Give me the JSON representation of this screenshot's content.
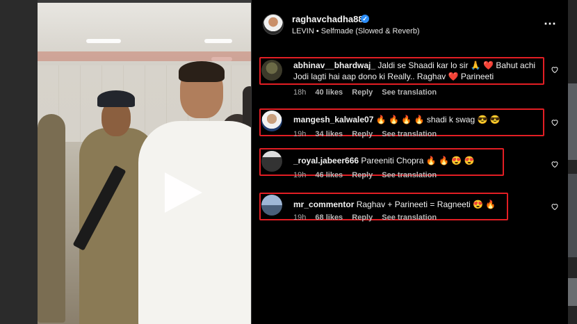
{
  "post": {
    "username": "raghavchadha88",
    "verified_mark": "✓",
    "audio": "LEVIN • Selfmade (Slowed & Reverb)",
    "more_icon": "⋯"
  },
  "video": {
    "play_icon": "play-icon"
  },
  "comments": [
    {
      "username": "abhinav__bhardwaj_",
      "text": "Jaldi se Shaadi kar lo sir 🙏 ❤️ Bahut achi Jodi lagti hai aap dono ki Really.. Raghav ❤️ Parineeti",
      "time": "18h",
      "likes": "40 likes",
      "reply": "Reply",
      "translate": "See translation"
    },
    {
      "username": "mangesh_kalwale07",
      "text": "🔥 🔥 🔥 🔥 shadi k swag 😎 😎",
      "time": "19h",
      "likes": "34 likes",
      "reply": "Reply",
      "translate": "See translation"
    },
    {
      "username": "_royal.jabeer666",
      "text": "Pareeniti Chopra 🔥 🔥 😍 😍",
      "time": "19h",
      "likes": "46 likes",
      "reply": "Reply",
      "translate": "See translation"
    },
    {
      "username": "mr_commentor",
      "text": "Raghav + Parineeti = Ragneeti 😍 🔥",
      "time": "19h",
      "likes": "68 likes",
      "reply": "Reply",
      "translate": "See translation"
    }
  ],
  "colors": {
    "highlight": "#e31e24",
    "verified": "#2b8cf6",
    "panel_bg": "#000000"
  }
}
